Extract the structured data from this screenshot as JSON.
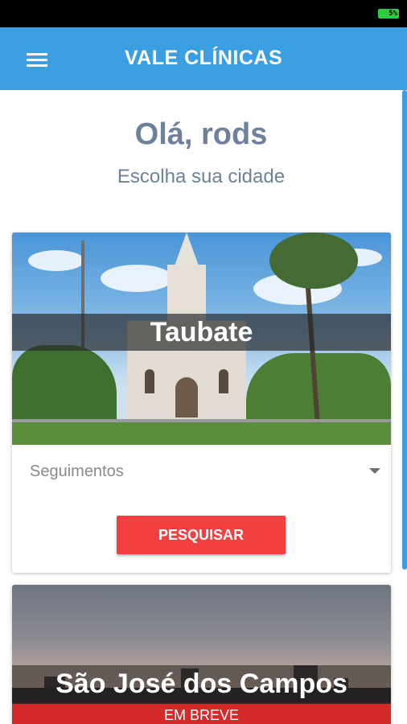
{
  "status_bar": {
    "battery_label": "5%"
  },
  "app_bar": {
    "title": "VALE CLÍNICAS",
    "menu_icon": "menu-icon"
  },
  "greeting": {
    "title": "Olá, rods",
    "subtitle": "Escolha sua cidade"
  },
  "cities": [
    {
      "name": "Taubate",
      "dropdown": {
        "selected": "Seguimentos"
      },
      "search_button": "PESQUISAR"
    },
    {
      "name": "São José dos Campos",
      "badge": "EM BREVE"
    }
  ],
  "colors": {
    "app_bar": "#3a9ee0",
    "text_muted": "#6f819a",
    "primary_button": "#f24040",
    "badge": "#d42a2a"
  }
}
